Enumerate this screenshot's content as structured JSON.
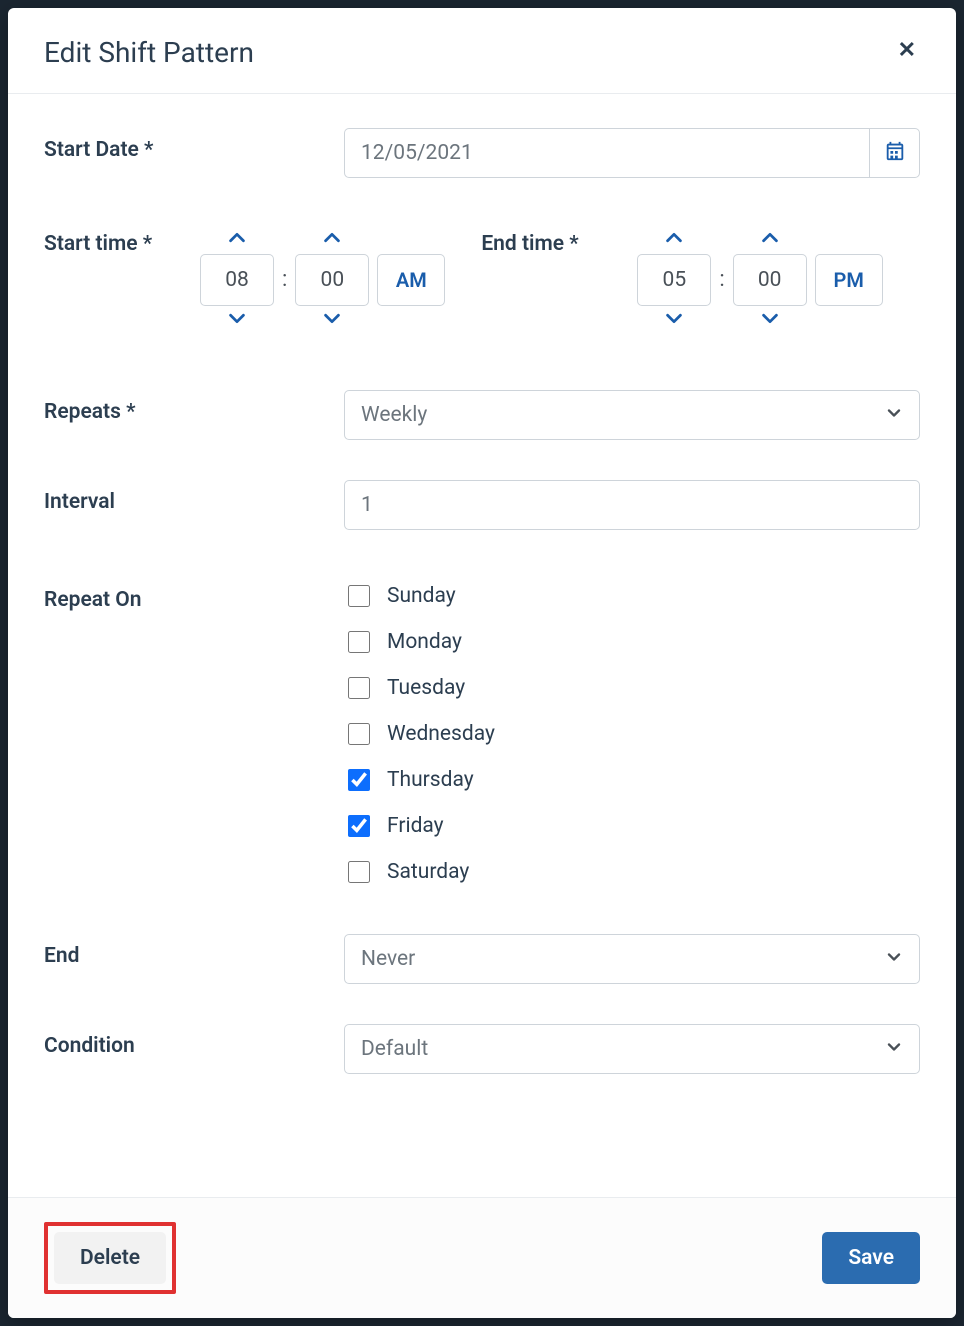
{
  "modal": {
    "title": "Edit Shift Pattern"
  },
  "fields": {
    "start_date_label": "Start Date *",
    "start_date_value": "12/05/2021",
    "start_time_label": "Start time *",
    "end_time_label": "End time *",
    "start_time": {
      "hour": "08",
      "minute": "00",
      "ampm": "AM"
    },
    "end_time": {
      "hour": "05",
      "minute": "00",
      "ampm": "PM"
    },
    "repeats_label": "Repeats *",
    "repeats_value": "Weekly",
    "interval_label": "Interval",
    "interval_value": "1",
    "repeat_on_label": "Repeat On",
    "days": [
      {
        "label": "Sunday",
        "checked": false
      },
      {
        "label": "Monday",
        "checked": false
      },
      {
        "label": "Tuesday",
        "checked": false
      },
      {
        "label": "Wednesday",
        "checked": false
      },
      {
        "label": "Thursday",
        "checked": true
      },
      {
        "label": "Friday",
        "checked": true
      },
      {
        "label": "Saturday",
        "checked": false
      }
    ],
    "end_label": "End",
    "end_value": "Never",
    "condition_label": "Condition",
    "condition_value": "Default"
  },
  "footer": {
    "delete_label": "Delete",
    "save_label": "Save"
  }
}
